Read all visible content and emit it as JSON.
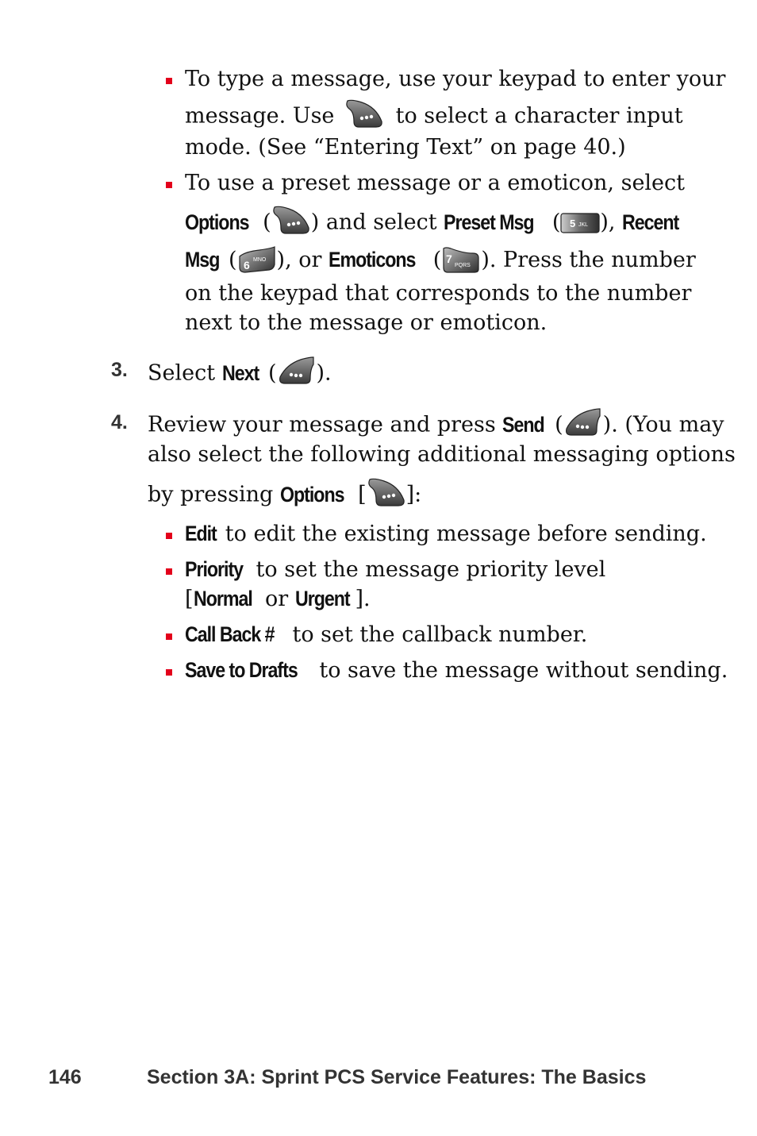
{
  "bullets_top": [
    {
      "lines": [
        "To type a message, use your keypad to enter your",
        [
          "message. Use ",
          {
            "icon": "softkey-right-icon"
          },
          " to select a character input"
        ],
        "mode. (See “Entering Text” on page 40.)"
      ]
    }
  ],
  "text": {
    "b1_l1": "To type a message, use your keypad to enter your",
    "b1_l2a": "message. Use",
    "b1_l2b": "to select a character input",
    "b1_l3": "mode. (See “Entering Text” on page 40.)",
    "b2_l1": "To use a preset message or a emoticon, select",
    "b2_l2_options": "Options",
    "b2_l2_a": " (",
    "b2_l2_b": ") and select ",
    "b2_l2_preset": "Preset Msg",
    "b2_l2_c": " (",
    "b2_l2_d": "), ",
    "b2_l2_recent": "Recent",
    "b2_l3_msg": "Msg",
    "b2_l3_a": " (",
    "b2_l3_b": "), or ",
    "b2_l3_emoticons": "Emoticons",
    "b2_l3_c": " (",
    "b2_l3_d": "). Press the number",
    "b2_l4": "on the keypad that corresponds to the number",
    "b2_l5": "next to the message or emoticon.",
    "step3_num": "3.",
    "step3_a": "Select ",
    "step3_next": "Next",
    "step3_b": " (",
    "step3_c": ").",
    "step4_num": "4.",
    "step4_l1_a": "Review your message and press ",
    "step4_l1_send": "Send",
    "step4_l1_b": " (",
    "step4_l1_c": "). (You may",
    "step4_l2": "also select the following additional messaging options",
    "step4_l3_a": "by pressing ",
    "step4_l3_options": "Options",
    "step4_l3_b": " [",
    "step4_l3_c": "]:",
    "opt_edit": "Edit",
    "opt_edit_desc": " to edit the existing message before sending.",
    "opt_priority": "Priority",
    "opt_priority_desc": " to set the message priority level",
    "opt_priority_l2_a": "[",
    "opt_priority_normal": "Normal",
    "opt_priority_or": " or ",
    "opt_priority_urgent": "Urgent",
    "opt_priority_l2_b": "].",
    "opt_callback": "Call Back #",
    "opt_callback_desc": " to set the callback number.",
    "opt_drafts": "Save to Drafts",
    "opt_drafts_desc": " to save the message without sending."
  },
  "keys": {
    "key5": {
      "digit": "5",
      "letters": "JKL"
    },
    "key6": {
      "digit": "6",
      "letters": "MNO"
    },
    "key7": {
      "digit": "7",
      "letters": "PQRS"
    }
  },
  "footer": {
    "page_number": "146",
    "section_title": "Section 3A: Sprint PCS Service Features: The Basics"
  },
  "colors": {
    "bullet": "#e3001b",
    "body_text": "#111111",
    "heading_text": "#333333"
  }
}
